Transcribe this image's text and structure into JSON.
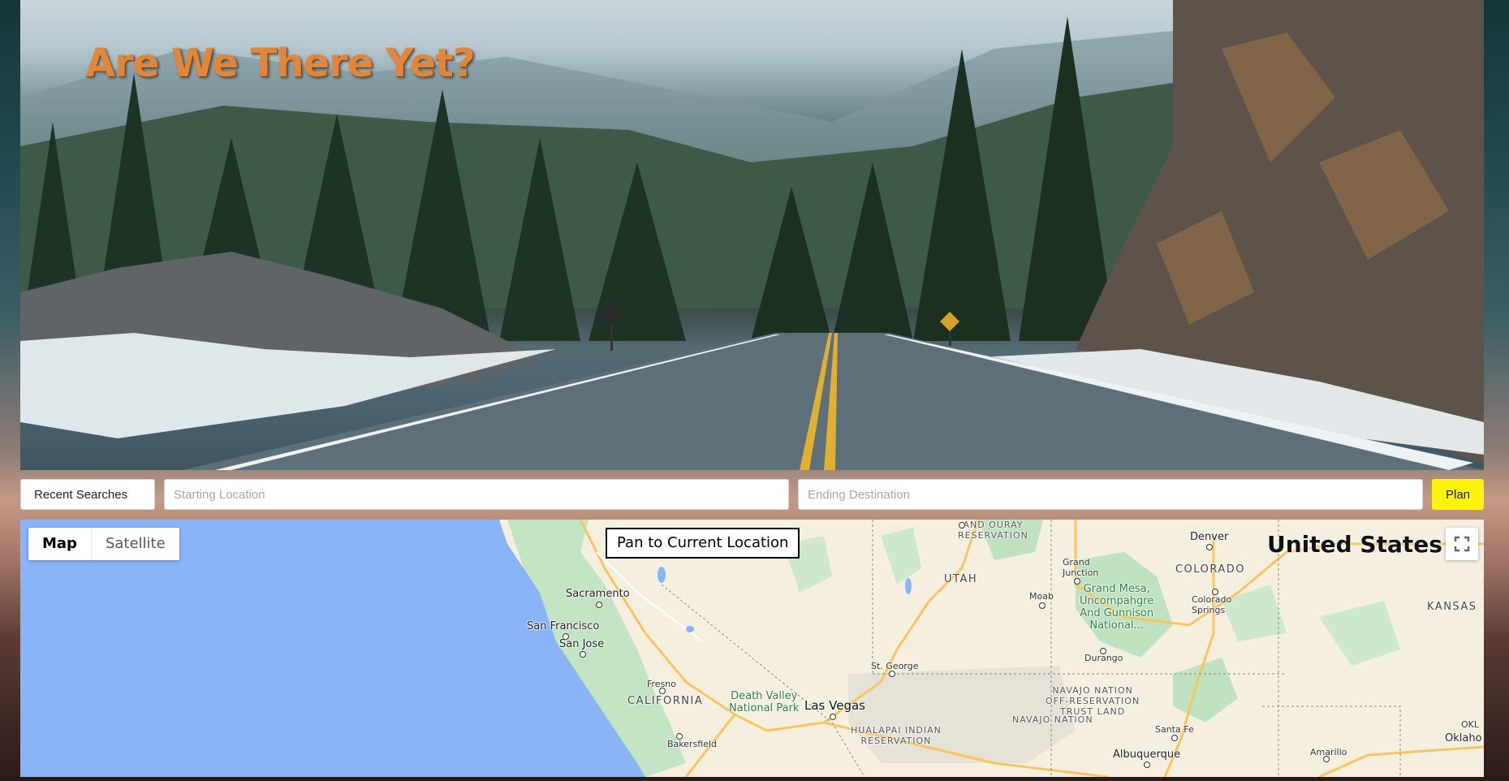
{
  "header": {
    "title": "Are We There Yet?"
  },
  "search": {
    "recent_label": "Recent Searches",
    "start_placeholder": "Starting Location",
    "end_placeholder": "Ending Destination",
    "plan_label": "Plan"
  },
  "map": {
    "type_control": {
      "map": "Map",
      "satellite": "Satellite",
      "selected": "Map"
    },
    "pan_label": "Pan to Current Location",
    "fullscreen_icon": "fullscreen-icon",
    "labels": {
      "country": "United States",
      "utah": "UTAH",
      "colorado": "COLORADO",
      "kansas": "KANSAS",
      "california": "CALIFORNIA",
      "denver": "Denver",
      "grand_junction": "Grand\nJunction",
      "moab": "Moab",
      "grand_mesa": "Grand Mesa,\nUncompahgre\nAnd Gunnison\nNational...",
      "colorado_springs": "Colorado\nSprings",
      "durango": "Durango",
      "sacramento": "Sacramento",
      "san_francisco": "San Francisco",
      "san_jose": "San Jose",
      "fresno": "Fresno",
      "death_valley": "Death Valley\nNational Park",
      "las_vegas": "Las Vegas",
      "st_george": "St. George",
      "hualapai": "HUALAPAI INDIAN\nRESERVATION",
      "navajo_off": "NAVAJO NATION\nOFF-RESERVATION\nTRUST LAND",
      "navajo": "NAVAJO NATION",
      "santa_fe": "Santa Fe",
      "albuquerque": "Albuquerque",
      "amarillo": "Amarillo",
      "bakersfield": "Bakersfield",
      "ouray": "AND OURAY\nRESERVATION",
      "okl": "OKL",
      "oklaho": "Oklaho"
    }
  },
  "colors": {
    "title": "#e0873b",
    "plan_button": "#fcf40b",
    "ocean": "#8ab4f8",
    "land": "#f5efe0",
    "park": "#b7dfb7"
  }
}
